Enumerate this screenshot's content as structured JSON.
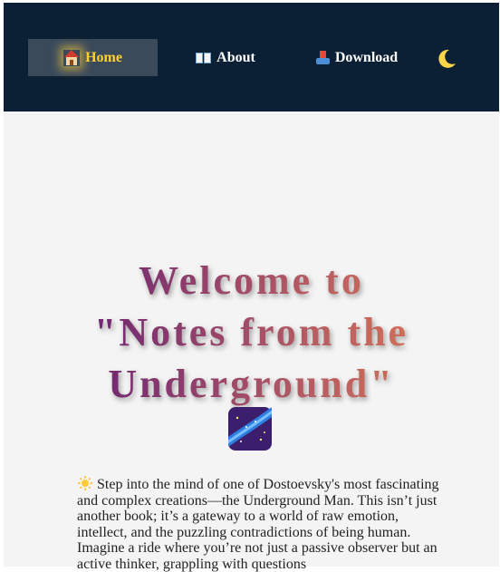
{
  "nav": {
    "items": [
      {
        "label": "Home",
        "icon": "house-icon",
        "active": true
      },
      {
        "label": "About",
        "icon": "open-book-icon"
      },
      {
        "label": "Download",
        "icon": "inbox-tray-icon"
      }
    ],
    "theme_toggle_icon": "crescent-moon-icon"
  },
  "hero": {
    "title_line1": "Welcome to",
    "title_line2": "\"Notes from the",
    "title_line3": "Underground\"",
    "emoji_icon": "milky-way-icon"
  },
  "intro": {
    "icon": "sun-icon",
    "text": "Step into the mind of one of Dostoevsky's most fascinating and complex creations—the Underground Man. This isn’t just another book; it’s a gateway to a world of raw emotion, intellect, and the puzzling contradictions of being human. Imagine a ride where you’re not just a passive observer but an active thinker, grappling with questions"
  },
  "colors": {
    "navbar": "#0b1f35",
    "active_nav_bg": "#3a4a5b",
    "active_nav_text": "#ffd233",
    "page_bg": "#f4f4f4",
    "title_gradient_start": "#6a2274",
    "title_gradient_end": "#e07a50"
  }
}
